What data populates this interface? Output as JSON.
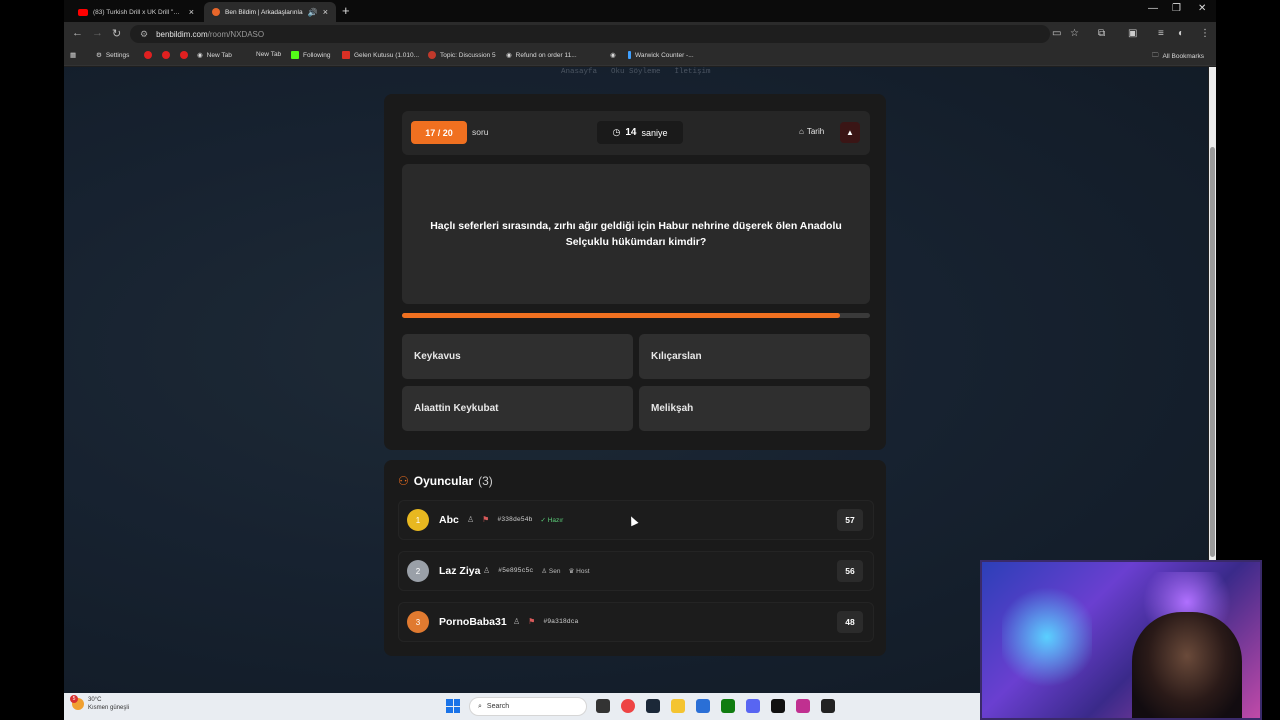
{
  "browser": {
    "tabs": [
      {
        "label": "(83) Turkish Drill x UK Drill \"AFF",
        "icon": "youtube-icon"
      },
      {
        "label": "Ben Bildim | Arkadaşlarınla",
        "icon": "benbildim-icon",
        "active": true
      }
    ],
    "url_host": "benbildim.com",
    "url_path": "/room/NXDASO",
    "bookmarks": [
      {
        "label": "Settings"
      },
      {
        "label": "New Tab"
      },
      {
        "label": "New Tab"
      },
      {
        "label": "Following"
      },
      {
        "label": "Gelen Kutusu (1.010..."
      },
      {
        "label": "Topic: Discussion 5"
      },
      {
        "label": "Refund on order 11..."
      },
      {
        "label": "Warwick Counter -..."
      }
    ],
    "all_bookmarks": "All Bookmarks"
  },
  "site_nav": [
    "Anasayfa",
    "Oku Söyleme",
    "İletişim"
  ],
  "quiz": {
    "counter": "17 / 20",
    "counter_suffix": "soru",
    "timer_value": "14",
    "timer_unit": "saniye",
    "category": "Tarih",
    "question": "Haçlı seferleri sırasında, zırhı ağır geldiği için Habur nehrine düşerek ölen Anadolu Selçuklu hükümdarı kimdir?",
    "progress": 0.935,
    "answers": [
      "Keykavus",
      "Kılıçarslan",
      "Alaattin Keykubat",
      "Melikşah"
    ]
  },
  "players": {
    "title": "Oyuncular",
    "count": "(3)",
    "list": [
      {
        "rank": "1",
        "name": "Abc",
        "code": "#338de54b",
        "tags": [
          "Hazır"
        ],
        "score": "57",
        "rank_color": "#e8b820"
      },
      {
        "rank": "2",
        "name": "Laz Ziya",
        "code": "#5e895c5c",
        "tags": [
          "Sen",
          "Host"
        ],
        "score": "56",
        "rank_color": "#9aa0a8"
      },
      {
        "rank": "3",
        "name": "PornoBaba31",
        "code": "#9a318dca",
        "tags": [],
        "score": "48",
        "rank_color": "#e07a30"
      }
    ]
  },
  "taskbar": {
    "temp": "30°C",
    "weather": "Kısmen güneşli",
    "weather_badge": "5",
    "search": "Search"
  },
  "colors": {
    "accent": "#f07020",
    "card": "#1a1a1a",
    "answer": "#2f2f2f"
  }
}
